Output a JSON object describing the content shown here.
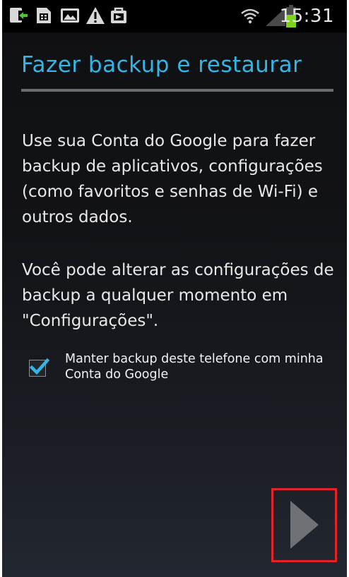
{
  "status_bar": {
    "time": "15:31",
    "icons": [
      "download-icon",
      "sim-card-icon",
      "image-icon",
      "warning-icon",
      "bag-icon",
      "wifi-icon",
      "signal-icon",
      "battery-icon"
    ]
  },
  "screen": {
    "title": "Fazer backup e restaurar",
    "paragraph_1": "Use sua Conta do Google para fazer backup de aplicativos, configurações (como favoritos e senhas de Wi-Fi) e outros dados.",
    "paragraph_2": "Você pode alterar as configurações de backup a qualquer momento em \"Configurações\".",
    "backup_checkbox": {
      "label": "Manter backup deste telefone com minha Conta do Google",
      "checked": true
    }
  },
  "colors": {
    "accent": "#33b5e5",
    "highlight_box": "#e2232b",
    "next_arrow": "#6f7174"
  }
}
